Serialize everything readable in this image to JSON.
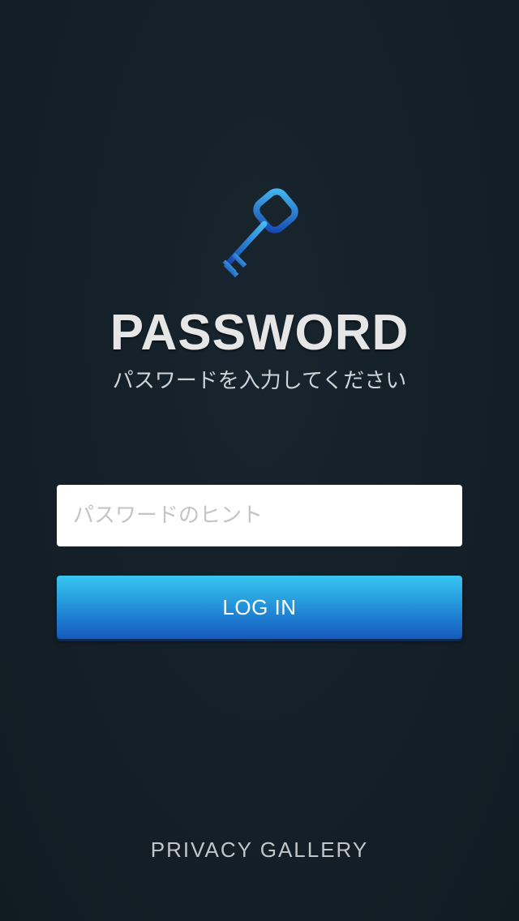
{
  "icons": {
    "key": "key-icon"
  },
  "colors": {
    "background": "#15212a",
    "button_top": "#38c6ee",
    "button_bottom": "#1559be",
    "key_light": "#3fa7ea",
    "key_dark": "#1a4fb3"
  },
  "header": {
    "title": "PASSWORD",
    "subtitle": "パスワードを入力してください"
  },
  "form": {
    "password_placeholder": "パスワードのヒント",
    "password_value": "",
    "login_label": "LOG IN"
  },
  "footer": {
    "brand": "PRIVACY GALLERY"
  }
}
